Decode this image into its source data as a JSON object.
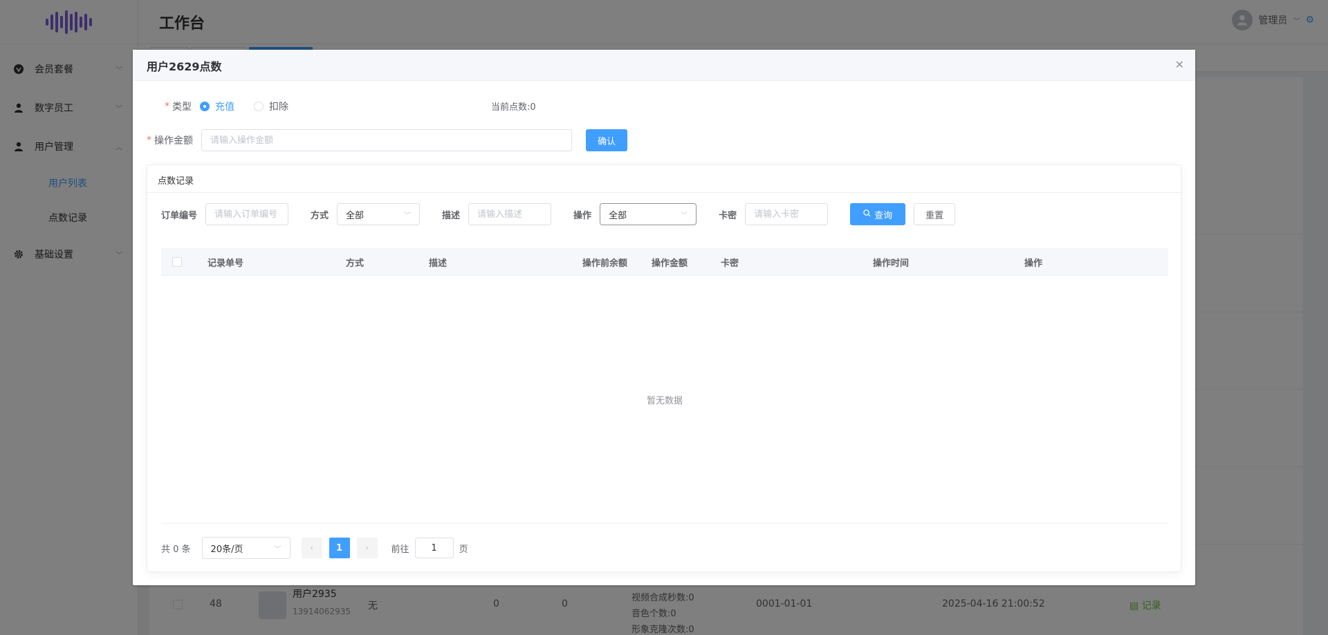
{
  "page": {
    "title": "工作台",
    "user": "管理员"
  },
  "sidebar": {
    "items": [
      {
        "label": "会员套餐",
        "icon": "vip-icon"
      },
      {
        "label": "数字员工",
        "icon": "person-icon"
      },
      {
        "label": "用户管理",
        "icon": "person-icon"
      },
      {
        "label": "用户列表"
      },
      {
        "label": "点数记录"
      },
      {
        "label": "基础设置",
        "icon": "gear-icon"
      }
    ]
  },
  "background_row": {
    "id": "48",
    "name": "用户2935",
    "phone": "13914062935",
    "col3": "无",
    "col4": "0",
    "col5": "0",
    "info1": "视频合成秒数:0",
    "info2": "音色个数:0",
    "info3": "形象克隆次数:0",
    "date": "0001-01-01",
    "time": "2025-04-16 21:00:52",
    "action": "记录"
  },
  "dialog": {
    "title": "用户2629点数",
    "type_label": "类型",
    "radio_recharge": "充值",
    "radio_deduct": "扣除",
    "current_points": "当前点数:0",
    "amount_label": "操作金额",
    "amount_placeholder": "请输入操作金额",
    "confirm": "确认",
    "records": {
      "title": "点数记录",
      "filters": {
        "order_label": "订单编号",
        "order_placeholder": "请输入订单编号",
        "method_label": "方式",
        "method_value": "全部",
        "desc_label": "描述",
        "desc_placeholder": "请输入描述",
        "op_label": "操作",
        "op_value": "全部",
        "card_label": "卡密",
        "card_placeholder": "请输入卡密",
        "query": "查询",
        "reset": "重置"
      },
      "columns": [
        "记录单号",
        "方式",
        "描述",
        "操作前余额",
        "操作金额",
        "卡密",
        "操作时间",
        "操作"
      ],
      "empty": "暂无数据",
      "pagination": {
        "total": "共 0 条",
        "page_size": "20条/页",
        "current_page": "1",
        "goto_label": "前往",
        "goto_value": "1",
        "page_suffix": "页"
      }
    }
  }
}
